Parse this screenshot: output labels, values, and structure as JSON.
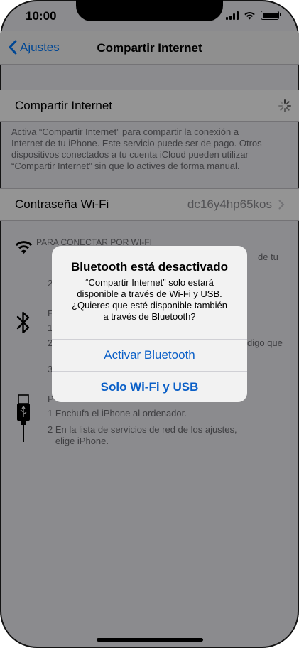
{
  "status": {
    "time": "10:00"
  },
  "nav": {
    "back_label": "Ajustes",
    "title": "Compartir Internet"
  },
  "hotspot": {
    "label": "Compartir Internet",
    "footnote_lines": [
      "Activa “Compartir Internet” para compartir la conexión a",
      "Internet de tu iPhone. Este servicio puede ser de pago. Otros",
      "dispositivos conectados a tu cuenta iCloud pueden utilizar",
      "“Compartir Internet” sin que lo actives de forma manual."
    ]
  },
  "password": {
    "label": "Contraseña Wi-Fi",
    "value": "dc16y4hp65kos"
  },
  "instructions": {
    "wifi": {
      "icon": "wifi-icon",
      "title": "PARA CONECTAR POR WI-FI",
      "lines": [
        "de tu",
        "2"
      ]
    },
    "bluetooth": {
      "icon": "bluetooth-icon",
      "lines": [
        "P",
        "1",
        "2",
        "digo que",
        "3"
      ]
    },
    "usb": {
      "icon": "usb-cable-icon",
      "title": "P",
      "lines": [
        "1 Enchufa el iPhone al ordenador.",
        "2 En la lista de servicios de red de los ajustes,",
        "   elige iPhone."
      ]
    }
  },
  "alert": {
    "title": "Bluetooth está desactivado",
    "message_lines": [
      "“Compartir Internet” solo estará",
      "disponible a través de Wi-Fi y USB.",
      "¿Quieres que esté disponible también",
      "a través de Bluetooth?"
    ],
    "primary_button": "Activar Bluetooth",
    "secondary_button": "Solo Wi-Fi y USB"
  },
  "colors": {
    "accent": "#007aff",
    "alert_button": "#0a5fc7"
  }
}
